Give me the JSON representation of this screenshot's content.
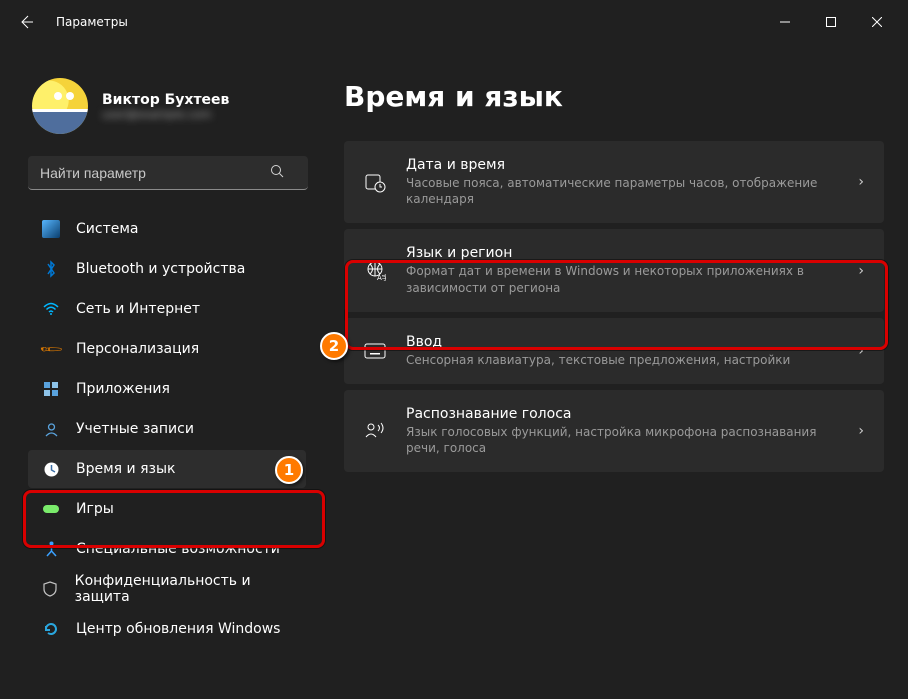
{
  "titlebar": {
    "app": "Параметры"
  },
  "user": {
    "name": "Виктор Бухтеев",
    "email": "user@example.com"
  },
  "search": {
    "placeholder": "Найти параметр"
  },
  "sidebar": {
    "items": [
      {
        "label": "Система"
      },
      {
        "label": "Bluetooth и устройства"
      },
      {
        "label": "Сеть и Интернет"
      },
      {
        "label": "Персонализация"
      },
      {
        "label": "Приложения"
      },
      {
        "label": "Учетные записи"
      },
      {
        "label": "Время и язык"
      },
      {
        "label": "Игры"
      },
      {
        "label": "Специальные возможности"
      },
      {
        "label": "Конфиденциальность и защита"
      },
      {
        "label": "Центр обновления Windows"
      }
    ]
  },
  "page": {
    "title": "Время и язык"
  },
  "cards": [
    {
      "title": "Дата и время",
      "desc": "Часовые пояса, автоматические параметры часов, отображение календаря"
    },
    {
      "title": "Язык и регион",
      "desc": "Формат дат и времени в Windows и некоторых приложениях в зависимости от региона"
    },
    {
      "title": "Ввод",
      "desc": "Сенсорная клавиатура, текстовые предложения, настройки"
    },
    {
      "title": "Распознавание голоса",
      "desc": "Язык голосовых функций, настройка микрофона распознавания речи, голоса"
    }
  ],
  "annotations": {
    "step1": "1",
    "step2": "2"
  }
}
